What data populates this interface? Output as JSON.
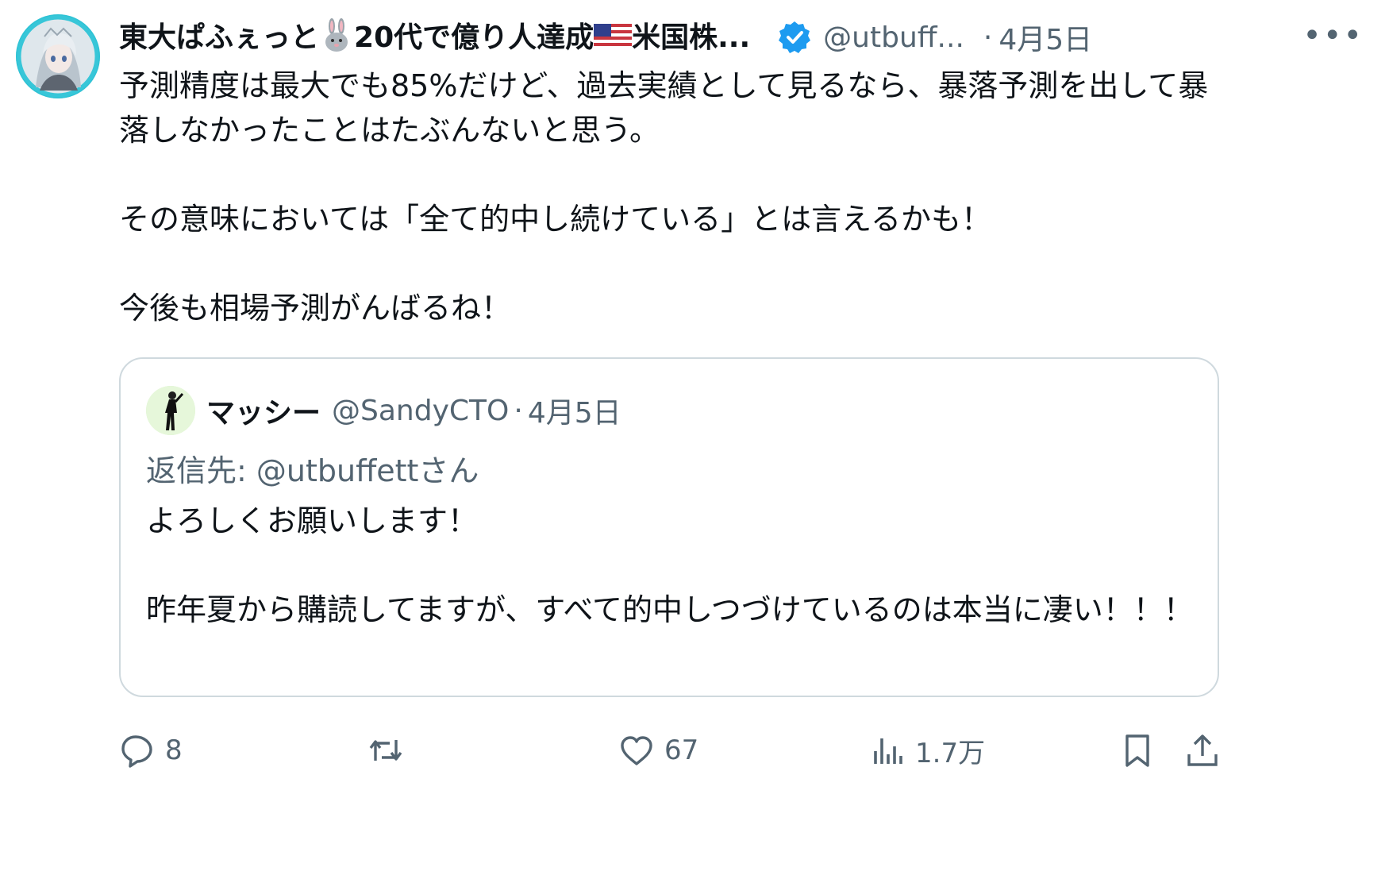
{
  "tweet": {
    "display_name": "東大ぱふぇっと",
    "display_name_tail": "20代で億り人達成",
    "display_name_tail2": "米国株...",
    "handle": "@utbuff...",
    "dot": "·",
    "date": "4月5日",
    "more": "•••",
    "body": [
      "予測精度は最大でも85%だけど、過去実績として見るなら、暴落予測を出して暴落しなかったことはたぶんないと思う。",
      "その意味においては「全て的中し続けている」とは言えるかも！",
      "今後も相場予測がんばるね！"
    ]
  },
  "quote": {
    "display_name": "マッシー",
    "handle": "@SandyCTO",
    "dot": "·",
    "date": "4月5日",
    "reply_to": "返信先: @utbuffettさん",
    "body": [
      "よろしくお願いします！",
      "昨年夏から購読してますが、すべて的中しつづけているのは本当に凄い！！！"
    ]
  },
  "actions": {
    "replies": "8",
    "retweets": "",
    "likes": "67",
    "views": "1.7万"
  },
  "icons": {
    "verified": "verified-badge-icon",
    "reply": "reply-icon",
    "retweet": "retweet-icon",
    "like": "heart-icon",
    "views": "views-icon",
    "bookmark": "bookmark-icon",
    "share": "share-icon"
  },
  "colors": {
    "verified_blue": "#1d9bf0",
    "secondary_text": "#536471",
    "primary_text": "#0f1419",
    "border": "#cfd9de"
  }
}
